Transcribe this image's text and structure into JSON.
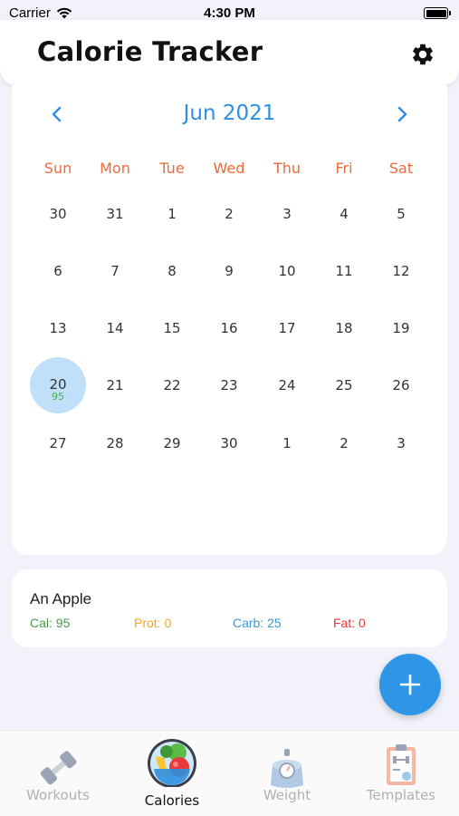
{
  "status_bar": {
    "carrier": "Carrier",
    "time": "4:30 PM"
  },
  "header": {
    "title": "Calorie Tracker",
    "settings_icon": "gear-icon"
  },
  "calendar": {
    "month_label": "Jun 2021",
    "prev_icon": "chevron-left-icon",
    "next_icon": "chevron-right-icon",
    "weekdays": [
      "Sun",
      "Mon",
      "Tue",
      "Wed",
      "Thu",
      "Fri",
      "Sat"
    ],
    "weeks": [
      [
        "30",
        "31",
        "1",
        "2",
        "3",
        "4",
        "5"
      ],
      [
        "6",
        "7",
        "8",
        "9",
        "10",
        "11",
        "12"
      ],
      [
        "13",
        "14",
        "15",
        "16",
        "17",
        "18",
        "19"
      ],
      [
        "20",
        "21",
        "22",
        "23",
        "24",
        "25",
        "26"
      ],
      [
        "27",
        "28",
        "29",
        "30",
        "1",
        "2",
        "3"
      ]
    ],
    "selected_day": "20",
    "selected_day_calories": "95",
    "accent_color": "#2f8fe0",
    "weekday_color": "#ef6a3a"
  },
  "food_entries": [
    {
      "name": "An Apple",
      "cal": "Cal: 95",
      "prot": "Prot: 0",
      "carb": "Carb: 25",
      "fat": "Fat: 0"
    }
  ],
  "fab": {
    "icon": "plus-icon",
    "color": "#2f95e6"
  },
  "tabs": [
    {
      "label": "Workouts",
      "icon": "dumbbell-icon",
      "active": false
    },
    {
      "label": "Calories",
      "icon": "fruit-bowl-icon",
      "active": true
    },
    {
      "label": "Weight",
      "icon": "scale-icon",
      "active": false
    },
    {
      "label": "Templates",
      "icon": "clipboard-icon",
      "active": false
    }
  ]
}
